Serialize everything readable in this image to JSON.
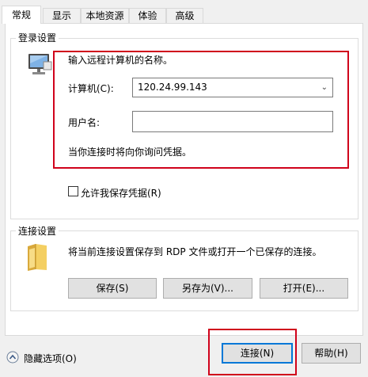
{
  "tabs": [
    {
      "label": "常规",
      "active": true
    },
    {
      "label": "显示",
      "active": false
    },
    {
      "label": "本地资源",
      "active": false
    },
    {
      "label": "体验",
      "active": false
    },
    {
      "label": "高级",
      "active": false
    }
  ],
  "login_group": {
    "legend": "登录设置",
    "prompt": "输入远程计算机的名称。",
    "computer_label": "计算机(C):",
    "computer_value": "120.24.99.143",
    "username_label": "用户名:",
    "username_value": "",
    "credentials_note": "当你连接时将向你询问凭据。",
    "allow_save_label": "允许我保存凭据(R)",
    "allow_save_checked": false
  },
  "connection_group": {
    "legend": "连接设置",
    "description": "将当前连接设置保存到 RDP 文件或打开一个已保存的连接。",
    "save_button": "保存(S)",
    "save_as_button": "另存为(V)...",
    "open_button": "打开(E)..."
  },
  "footer": {
    "hide_options": "隐藏选项(O)",
    "connect_button": "连接(N)",
    "help_button": "帮助(H)"
  },
  "colors": {
    "highlight_box": "#d0021b",
    "default_button_border": "#0078d7"
  }
}
